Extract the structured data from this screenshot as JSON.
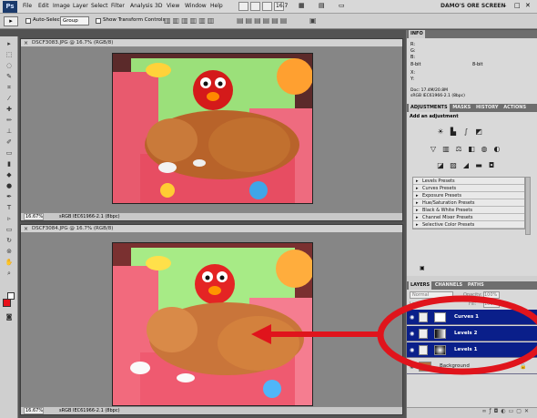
{
  "app": {
    "logo": "Ps",
    "zoom": "16.7",
    "workspace": "DAMO'S ORE SCREEN"
  },
  "menu": [
    "File",
    "Edit",
    "Image",
    "Layer",
    "Select",
    "Filter",
    "Analysis",
    "3D",
    "View",
    "Window",
    "Help"
  ],
  "options": {
    "auto_select_label": "Auto-Select:",
    "auto_select_value": "Group",
    "transform_label": "Show Transform Controls"
  },
  "documents": [
    {
      "title": "DSCF3083.JPG @ 16.7% (RGB/8)",
      "zoom": "16.67%",
      "profile": "sRGB IEC61966-2.1 (8bpc)"
    },
    {
      "title": "DSCF3084.JPG @ 16.7% (RGB/8)",
      "zoom": "16.67%",
      "profile": "sRGB IEC61966-2.1 (8bpc)"
    }
  ],
  "info_panel": {
    "tab": "INFO",
    "rows": [
      "R:",
      "G:",
      "B:",
      "8-bit",
      "X:",
      "Y:"
    ],
    "doc": "Doc: 17.4M/20.8M",
    "profile": "sRGB IEC61966-2.1 (8bpc)"
  },
  "adjust_panel": {
    "tabs": [
      "ADJUSTMENTS",
      "MASKS",
      "HISTORY",
      "ACTIONS"
    ],
    "title": "Add an adjustment",
    "presets": [
      "Levels Presets",
      "Curves Presets",
      "Exposure Presets",
      "Hue/Saturation Presets",
      "Black & White Presets",
      "Channel Mixer Presets",
      "Selective Color Presets"
    ]
  },
  "layers_panel": {
    "tabs": [
      "LAYERS",
      "CHANNELS",
      "PATHS"
    ],
    "blend": "Normal",
    "opacity_label": "Opacity:",
    "opacity": "100%",
    "fill_label": "Fill:",
    "fill": "100%",
    "lock_label": "Lock:",
    "layers": [
      {
        "name": "Curves 1",
        "selected": true
      },
      {
        "name": "Levels 2",
        "selected": true
      },
      {
        "name": "Levels 1",
        "selected": true
      },
      {
        "name": "Background",
        "selected": false
      }
    ]
  },
  "colors": {
    "foreground": "#e8101a",
    "selection": "#0a1f8a",
    "annotation": "#e0141c"
  }
}
